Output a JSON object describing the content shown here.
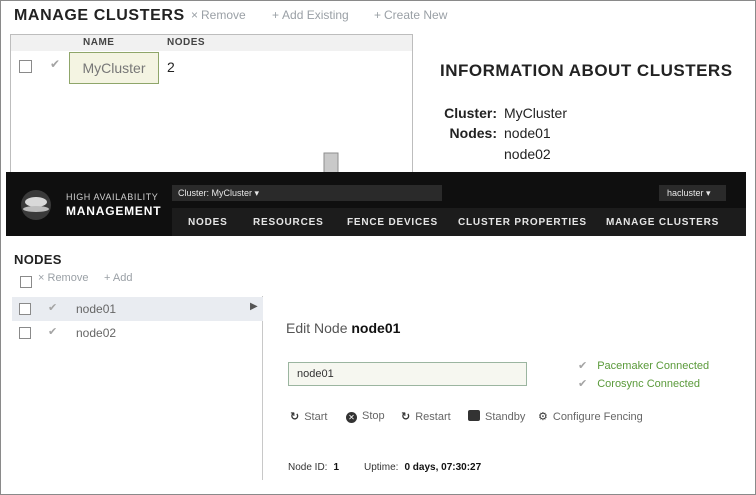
{
  "manage_clusters": {
    "title": "MANAGE CLUSTERS",
    "actions": [
      {
        "icon": "remove-icon",
        "glyph": "×",
        "label": "Remove"
      },
      {
        "icon": "plus-icon",
        "glyph": "+",
        "label": "Add Existing"
      },
      {
        "icon": "plus-icon",
        "glyph": "+",
        "label": "Create New"
      }
    ],
    "columns": {
      "name": "NAME",
      "nodes": "NODES"
    },
    "rows": [
      {
        "name": "MyCluster",
        "nodes": "2"
      }
    ]
  },
  "info": {
    "title": "INFORMATION ABOUT CLUSTERS",
    "cluster_label": "Cluster:",
    "cluster_value": "MyCluster",
    "nodes_label": "Nodes:",
    "nodes": [
      "node01",
      "node02"
    ]
  },
  "header": {
    "brand_line1": "HIGH AVAILABILITY",
    "brand_line2": "MANAGEMENT",
    "cluster_select": "Cluster: MyCluster ▾",
    "user_menu": "hacluster ▾",
    "nav": [
      "NODES",
      "RESOURCES",
      "FENCE DEVICES",
      "CLUSTER PROPERTIES",
      "MANAGE CLUSTERS"
    ]
  },
  "nodes_panel": {
    "title": "NODES",
    "actions": [
      {
        "glyph": "×",
        "label": "Remove"
      },
      {
        "glyph": "+",
        "label": "Add"
      }
    ],
    "nodes": [
      {
        "name": "node01",
        "selected": true
      },
      {
        "name": "node02",
        "selected": false
      }
    ]
  },
  "edit_node": {
    "title_prefix": "Edit Node",
    "title_node": "node01",
    "node_name_value": "node01",
    "services": [
      "Pacemaker Connected",
      "Corosync Connected"
    ],
    "actions": [
      "Start",
      "Stop",
      "Restart",
      "Standby",
      "Configure Fencing"
    ],
    "node_id_label": "Node ID:",
    "node_id": "1",
    "uptime_label": "Uptime:",
    "uptime": "0 days, 07:30:27"
  },
  "colors": {
    "header_bg": "#0f0f0f",
    "connected_green": "#5a9a3a",
    "selected_row": "#e9ecf1"
  }
}
